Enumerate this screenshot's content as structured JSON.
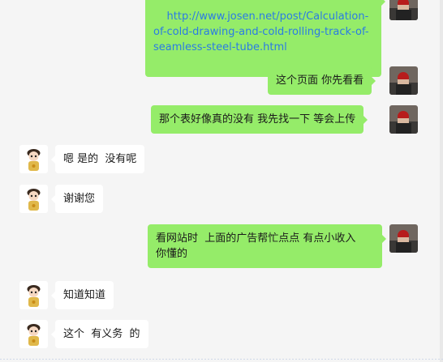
{
  "messages": [
    {
      "side": "right",
      "kind": "link",
      "text": "http://www.josen.net/post/Calculation-of-cold-drawing-and-cold-rolling-track-of-seamless-steel-tube.html"
    },
    {
      "side": "right",
      "kind": "text",
      "text": "这个页面 你先看看"
    },
    {
      "side": "right",
      "kind": "text",
      "text": "那个表好像真的没有 我先找一下 等会上传"
    },
    {
      "side": "left",
      "kind": "text",
      "text": "嗯 是的  没有呢"
    },
    {
      "side": "left",
      "kind": "text",
      "text": "谢谢您"
    },
    {
      "side": "right",
      "kind": "text",
      "text": "看网站时  上面的广告帮忙点点 有点小收入\n你懂的"
    },
    {
      "side": "left",
      "kind": "text",
      "text": "知道知道"
    },
    {
      "side": "left",
      "kind": "text",
      "text": "这个  有义务  的"
    }
  ],
  "colors": {
    "sent_bubble": "#95ec69",
    "received_bubble": "#ffffff",
    "background": "#f5f5f5",
    "link": "#2a7be4"
  },
  "icons": {
    "self_avatar": "person-red-helmet-avatar",
    "contact_avatar": "cartoon-doll-avatar"
  }
}
